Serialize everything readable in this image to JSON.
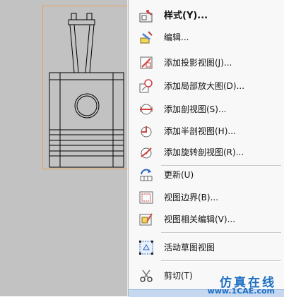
{
  "menu": {
    "items": [
      {
        "label": "样式(Y)...",
        "icon": "style-icon"
      },
      {
        "label": "编辑...",
        "icon": "edit-icon"
      },
      {
        "label": "添加投影视图(J)...",
        "icon": "projected-view-icon"
      },
      {
        "label": "添加局部放大图(D)...",
        "icon": "detail-view-icon"
      },
      {
        "label": "添加剖视图(S)...",
        "icon": "section-view-icon"
      },
      {
        "label": "添加半剖视图(H)...",
        "icon": "half-section-view-icon"
      },
      {
        "label": "添加旋转剖视图(R)...",
        "icon": "revolved-section-view-icon"
      },
      {
        "label": "更新(U)",
        "icon": "update-icon"
      },
      {
        "label": "视图边界(B)...",
        "icon": "view-boundary-icon"
      },
      {
        "label": "视图相关编辑(V)...",
        "icon": "view-dependent-edit-icon"
      },
      {
        "label": "活动草图视图",
        "icon": "active-sketch-view-icon"
      },
      {
        "label": "剪切(T)",
        "icon": "cut-icon"
      }
    ]
  },
  "watermark": {
    "title": "仿真在线",
    "url": "www.1CAE.com"
  },
  "colors": {
    "viewport_bg": "#c2c2c2",
    "menu_bg": "#f8f8f8",
    "view_border": "#e8a25a",
    "watermark": "#1e6fc4"
  }
}
